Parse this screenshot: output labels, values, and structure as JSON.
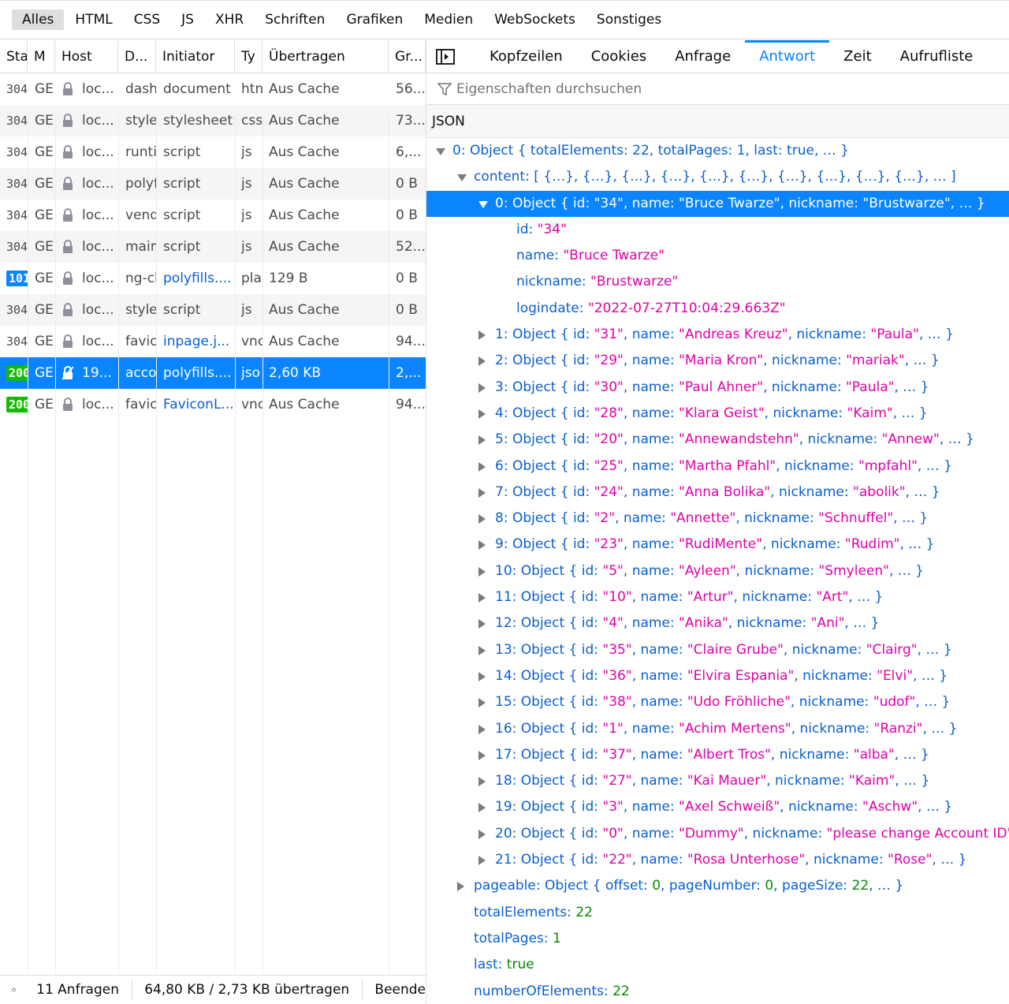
{
  "filter_tabs": [
    "Alles",
    "HTML",
    "CSS",
    "JS",
    "XHR",
    "Schriften",
    "Grafiken",
    "Medien",
    "WebSockets",
    "Sonstiges"
  ],
  "columns": [
    "Sta",
    "M",
    "Host",
    "D...",
    "Initiator",
    "Ty",
    "Übertragen",
    "Gr..."
  ],
  "requests": [
    {
      "status": "304",
      "method": "GE",
      "host": "loc...",
      "file": "dash",
      "initiator": "document",
      "type": "htn",
      "transferred": "Aus Cache",
      "size": "56..."
    },
    {
      "status": "304",
      "method": "GE",
      "host": "loc...",
      "file": "style",
      "initiator": "stylesheet",
      "type": "css",
      "transferred": "Aus Cache",
      "size": "73..."
    },
    {
      "status": "304",
      "method": "GE",
      "host": "loc...",
      "file": "runti",
      "initiator": "script",
      "type": "js",
      "transferred": "Aus Cache",
      "size": "6,..."
    },
    {
      "status": "304",
      "method": "GE",
      "host": "loc...",
      "file": "polyf",
      "initiator": "script",
      "type": "js",
      "transferred": "Aus Cache",
      "size": "0 B"
    },
    {
      "status": "304",
      "method": "GE",
      "host": "loc...",
      "file": "vend",
      "initiator": "script",
      "type": "js",
      "transferred": "Aus Cache",
      "size": "0 B"
    },
    {
      "status": "304",
      "method": "GE",
      "host": "loc...",
      "file": "main",
      "initiator": "script",
      "type": "js",
      "transferred": "Aus Cache",
      "size": "52..."
    },
    {
      "status": "101",
      "method": "GE",
      "host": "loc...",
      "file": "ng-cl",
      "initiator": "polyfills....",
      "type": "pla",
      "transferred": "129 B",
      "size": "0 B"
    },
    {
      "status": "304",
      "method": "GE",
      "host": "loc...",
      "file": "style",
      "initiator": "script",
      "type": "js",
      "transferred": "Aus Cache",
      "size": "0 B"
    },
    {
      "status": "304",
      "method": "GE",
      "host": "loc...",
      "file": "favic",
      "initiator": "inpage.j...",
      "type": "vnc",
      "transferred": "Aus Cache",
      "size": "94..."
    },
    {
      "status": "200",
      "method": "GE",
      "host": "19...",
      "file": "acco",
      "initiator": "polyfills....",
      "type": "jso",
      "transferred": "2,60 KB",
      "size": "2,..."
    },
    {
      "status": "200",
      "method": "GE",
      "host": "loc...",
      "file": "favic",
      "initiator": "FaviconL...",
      "type": "vnc",
      "transferred": "Aus Cache",
      "size": "94..."
    }
  ],
  "footer": {
    "count": "11 Anfragen",
    "transferred": "64,80 KB / 2,73 KB übertragen",
    "finished": "Beende"
  },
  "detail_tabs": [
    "Kopfzeilen",
    "Cookies",
    "Anfrage",
    "Antwort",
    "Zeit",
    "Aufrufliste"
  ],
  "search_placeholder": "Eigenschaften durchsuchen",
  "json_header": "JSON",
  "root_summary": "0: Object { totalElements: 22, totalPages: 1, last: true, … }",
  "content_summary": "content: [ {…}, {…}, {…}, {…}, {…}, {…}, {…}, {…}, {…}, {…}, … ]",
  "expanded": {
    "summary": "0: Object { id: \"34\", name: \"Bruce Twarze\", nickname: \"Brustwarze\", … }",
    "fields": [
      {
        "key": "id",
        "value": "\"34\""
      },
      {
        "key": "name",
        "value": "\"Bruce Twarze\""
      },
      {
        "key": "nickname",
        "value": "\"Brustwarze\""
      },
      {
        "key": "logindate",
        "value": "\"2022-07-27T10:04:29.663Z\""
      }
    ]
  },
  "objects": [
    {
      "idx": "1",
      "id": "\"31\"",
      "name": "\"Andreas Kreuz\"",
      "nickname": "\"Paula\""
    },
    {
      "idx": "2",
      "id": "\"29\"",
      "name": "\"Maria Kron\"",
      "nickname": "\"mariak\""
    },
    {
      "idx": "3",
      "id": "\"30\"",
      "name": "\"Paul Ahner\"",
      "nickname": "\"Paula\""
    },
    {
      "idx": "4",
      "id": "\"28\"",
      "name": "\"Klara Geist\"",
      "nickname": "\"Kaim\""
    },
    {
      "idx": "5",
      "id": "\"20\"",
      "name": "\"Annewandstehn\"",
      "nickname": "\"Annew\""
    },
    {
      "idx": "6",
      "id": "\"25\"",
      "name": "\"Martha Pfahl\"",
      "nickname": "\"mpfahl\""
    },
    {
      "idx": "7",
      "id": "\"24\"",
      "name": "\"Anna Bolika\"",
      "nickname": "\"abolik\""
    },
    {
      "idx": "8",
      "id": "\"2\"",
      "name": "\"Annette\"",
      "nickname": "\"Schnuffel\""
    },
    {
      "idx": "9",
      "id": "\"23\"",
      "name": "\"RudiMente\"",
      "nickname": "\"Rudim\""
    },
    {
      "idx": "10",
      "id": "\"5\"",
      "name": "\"Ayleen\"",
      "nickname": "\"Smyleen\""
    },
    {
      "idx": "11",
      "id": "\"10\"",
      "name": "\"Artur\"",
      "nickname": "\"Art\""
    },
    {
      "idx": "12",
      "id": "\"4\"",
      "name": "\"Anika\"",
      "nickname": "\"Ani\""
    },
    {
      "idx": "13",
      "id": "\"35\"",
      "name": "\"Claire Grube\"",
      "nickname": "\"Clairg\""
    },
    {
      "idx": "14",
      "id": "\"36\"",
      "name": "\"Elvira Espania\"",
      "nickname": "\"Elvi\""
    },
    {
      "idx": "15",
      "id": "\"38\"",
      "name": "\"Udo Fröhliche\"",
      "nickname": "\"udof\""
    },
    {
      "idx": "16",
      "id": "\"1\"",
      "name": "\"Achim Mertens\"",
      "nickname": "\"Ranzi\""
    },
    {
      "idx": "17",
      "id": "\"37\"",
      "name": "\"Albert Tros\"",
      "nickname": "\"alba\""
    },
    {
      "idx": "18",
      "id": "\"27\"",
      "name": "\"Kai Mauer\"",
      "nickname": "\"Kaim\""
    },
    {
      "idx": "19",
      "id": "\"3\"",
      "name": "\"Axel Schweiß\"",
      "nickname": "\"Aschw\""
    },
    {
      "idx": "20",
      "id": "\"0\"",
      "name": "\"Dummy\"",
      "nickname": "\"please change Account ID\""
    },
    {
      "idx": "21",
      "id": "\"22\"",
      "name": "\"Rosa Unterhose\"",
      "nickname": "\"Rose\""
    }
  ],
  "pageable": {
    "label": "pageable:",
    "summary_prefix": "Object { offset: ",
    "offset": "0",
    "pn_label": ", pageNumber: ",
    "pn": "0",
    "ps_label": ", pageSize: ",
    "ps": "22",
    "suffix": ", … }"
  },
  "totals": [
    {
      "key": "totalElements:",
      "value": "22"
    },
    {
      "key": "totalPages:",
      "value": "1"
    },
    {
      "key": "last:",
      "value": "true"
    },
    {
      "key": "numberOfElements:",
      "value": "22"
    }
  ],
  "colors": {
    "accent": "#0a84ff",
    "key": "#0a5fcf",
    "string": "#dd00a9",
    "number": "#058b00",
    "status200": "#12bc00"
  }
}
